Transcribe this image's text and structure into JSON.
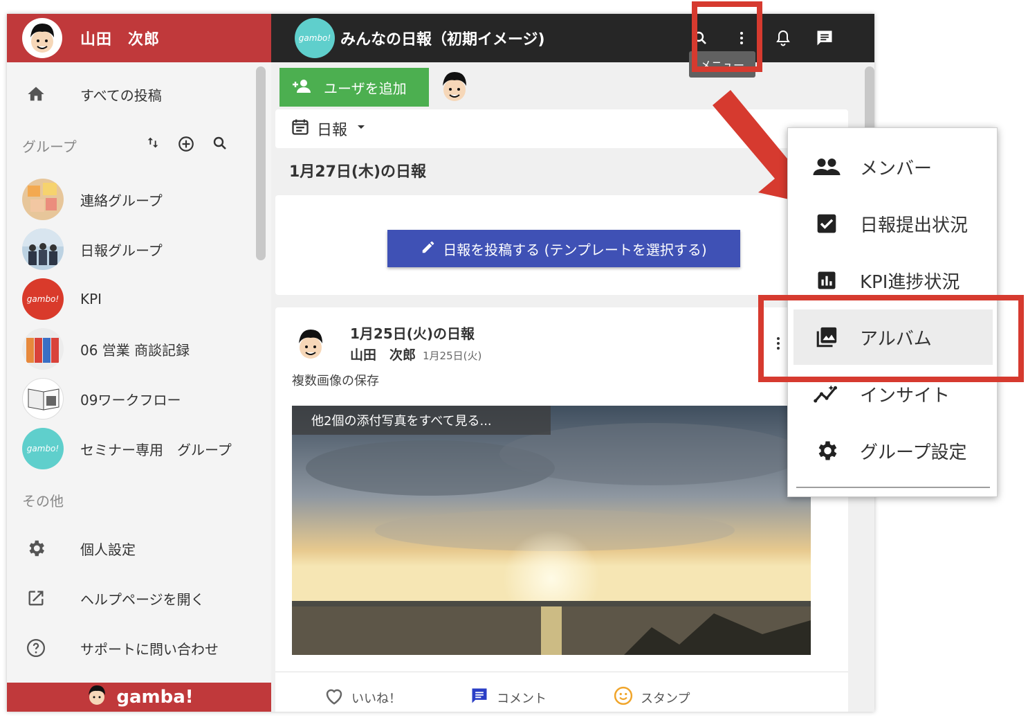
{
  "sidebar": {
    "user_name": "山田　次郎",
    "all_posts": "すべての投稿",
    "groups_label": "グループ",
    "groups": [
      {
        "label": "連絡グループ"
      },
      {
        "label": "日報グループ"
      },
      {
        "label": "KPI"
      },
      {
        "label": "06 営業 商談記録"
      },
      {
        "label": "09ワークフロー"
      },
      {
        "label": "セミナー専用　グループ"
      }
    ],
    "others_label": "その他",
    "others": [
      {
        "label": "個人設定"
      },
      {
        "label": "ヘルプページを開く"
      },
      {
        "label": "サポートに問い合わせ"
      }
    ],
    "footer_brand": "gamba!"
  },
  "header": {
    "logo_text": "gambo!",
    "title": "みんなの日報（初期イメージ)",
    "tooltip": "メニュー"
  },
  "main": {
    "add_user": "ユーザを追加",
    "selector": "日報",
    "date_title": "1月27日(木)の日報",
    "post_button": "日報を投稿する (テンプレートを選択する)",
    "card": {
      "title": "1月25日(火)の日報",
      "author": "山田　次郎",
      "date": "1月25日(火)",
      "body": "複数画像の保存",
      "photo_overlay": "他2個の添付写真をすべて見る...",
      "actions": {
        "like": "いいね！",
        "comment": "コメント",
        "stamp": "スタンプ"
      }
    }
  },
  "menu": {
    "items": [
      {
        "label": "メンバー",
        "icon": "people-icon"
      },
      {
        "label": "日報提出状況",
        "icon": "checkbox-icon"
      },
      {
        "label": "KPI進捗状況",
        "icon": "bar-chart-icon"
      },
      {
        "label": "アルバム",
        "icon": "photo-album-icon"
      },
      {
        "label": "インサイト",
        "icon": "insights-icon"
      },
      {
        "label": "グループ設定",
        "icon": "gear-icon"
      }
    ]
  },
  "colors": {
    "brand_red": "#c0393b",
    "topbar": "#262626",
    "annotation_red": "#d63a2f",
    "add_user_green": "#4caf50",
    "post_button_blue": "#3f51b5",
    "gambo_teal": "#5fcfcc"
  }
}
